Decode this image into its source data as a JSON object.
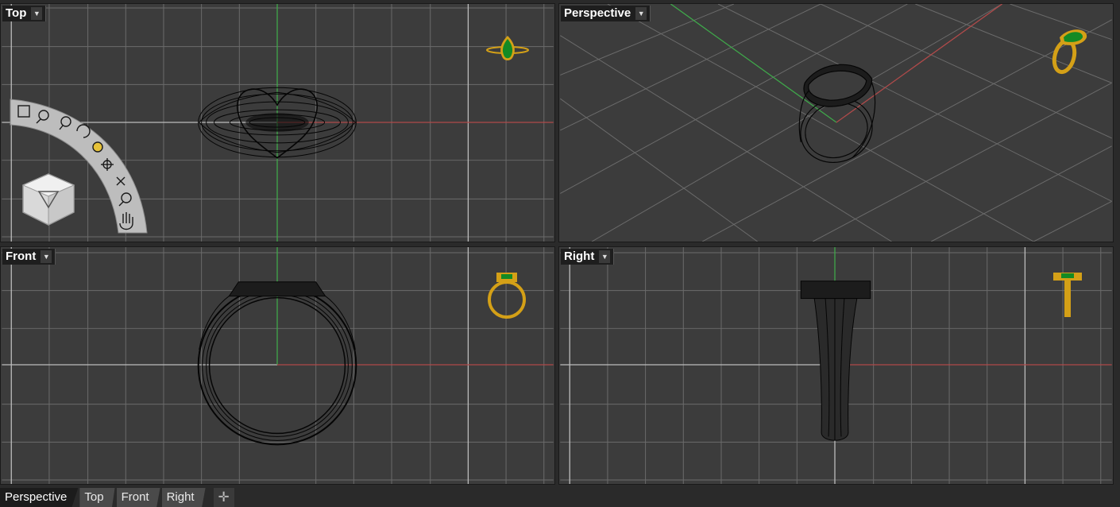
{
  "viewports": {
    "top": {
      "label": "Top"
    },
    "perspective": {
      "label": "Perspective"
    },
    "front": {
      "label": "Front"
    },
    "right": {
      "label": "Right"
    }
  },
  "menu_caret_icon": "triangle-down-icon",
  "tabs": [
    {
      "label": "Perspective",
      "active": true
    },
    {
      "label": "Top",
      "active": false
    },
    {
      "label": "Front",
      "active": false
    },
    {
      "label": "Right",
      "active": false
    }
  ],
  "add_tab_icon": "plus-icon",
  "nav_tools": [
    "zoom-extents-icon",
    "zoom-window-icon",
    "zoom-selected-icon",
    "rotate-view-icon",
    "zoom-target-icon",
    "target-icon",
    "pan-cross-icon",
    "zoom-icon",
    "hand-pan-icon"
  ],
  "colors": {
    "viewport_bg": "#3c3c3c",
    "grid": "#6b6b6b",
    "x_axis": "#b04a4a",
    "y_axis": "#3fa84a",
    "gold": "#d4a017",
    "emerald": "#1a8a2a"
  }
}
